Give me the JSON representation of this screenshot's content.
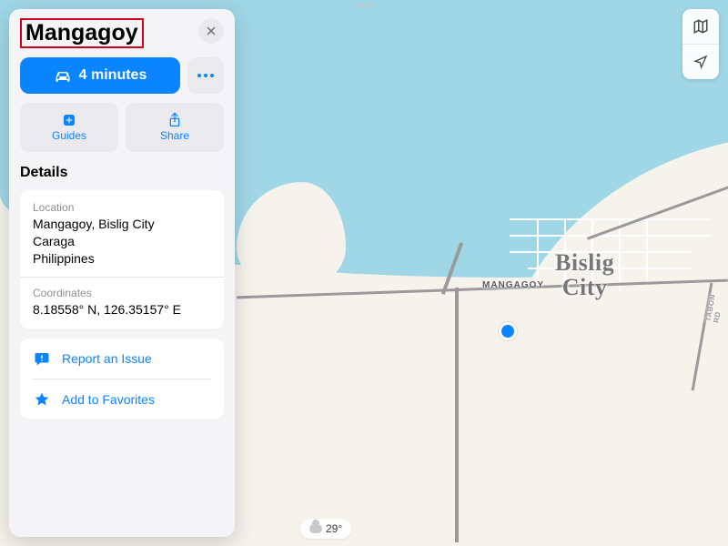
{
  "place": {
    "name": "Mangagoy",
    "directions_label": "4 minutes"
  },
  "buttons": {
    "guides": "Guides",
    "share": "Share",
    "report": "Report an Issue",
    "favorite": "Add to Favorites"
  },
  "details": {
    "heading": "Details",
    "location_label": "Location",
    "location_line1": "Mangagoy, Bislig City",
    "location_line2": "Caraga",
    "location_line3": "Philippines",
    "coords_label": "Coordinates",
    "coords_value": "8.18558° N, 126.35157° E"
  },
  "map_labels": {
    "city": "Bislig\nCity",
    "mangagoy": "MANGAGOY",
    "road": "TABON RD"
  },
  "weather": {
    "temp": "29°"
  },
  "icons": {
    "car": "car-icon",
    "close": "close-icon",
    "guides_plus": "plus-square-icon",
    "share": "share-icon",
    "report": "exclamation-bubble-icon",
    "star": "star-icon",
    "map_mode": "map-mode-icon",
    "locate": "location-arrow-icon",
    "cloud": "cloud-icon"
  }
}
